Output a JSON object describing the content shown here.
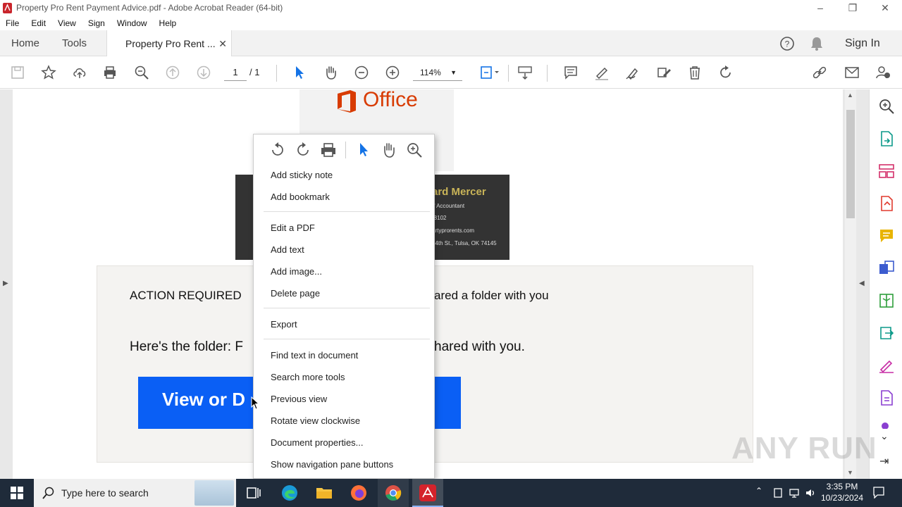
{
  "window": {
    "title": "Property Pro Rent  Payment Advice.pdf - Adobe Acrobat Reader (64-bit)"
  },
  "menu": [
    "File",
    "Edit",
    "View",
    "Sign",
    "Window",
    "Help"
  ],
  "tabs": {
    "home": "Home",
    "tools": "Tools",
    "document": "Property Pro Rent ...",
    "sign_in": "Sign In"
  },
  "toolbar": {
    "page_current": "1",
    "page_total": "/ 1",
    "zoom": "114%"
  },
  "document": {
    "office_logo_text": "Office",
    "card_name": "ard Mercer",
    "card_title": "ff Accountant",
    "card_phone": "-8102",
    "card_email": "artyprorents.com",
    "card_address": "44th St., Tulsa, OK 74145",
    "action_left": "ACTION REQUIRED",
    "action_right": "ared a folder with you",
    "folder_left": "Here's the folder: F",
    "folder_right": "hared with you.",
    "button_text": "View or D"
  },
  "context_menu": {
    "items_group1": [
      "Add sticky note",
      "Add bookmark"
    ],
    "items_group2": [
      "Edit a PDF",
      "Add text",
      "Add image...",
      "Delete page"
    ],
    "items_group3": [
      "Export"
    ],
    "items_group4": [
      "Find text in document",
      "Search more tools",
      "Previous view",
      "Rotate view clockwise",
      "Document properties...",
      "Show navigation pane buttons"
    ]
  },
  "watermark": "ANY RUN",
  "taskbar": {
    "search_placeholder": "Type here to search",
    "time": "3:35 PM",
    "date": "10/23/2024"
  },
  "colors": {
    "accent_blue": "#1473e6",
    "office_red": "#d83b01",
    "doc_button_blue": "#0a5ff5",
    "card_bg": "#333333",
    "card_name": "#c9b458",
    "taskbar": "#1f2b3a"
  }
}
